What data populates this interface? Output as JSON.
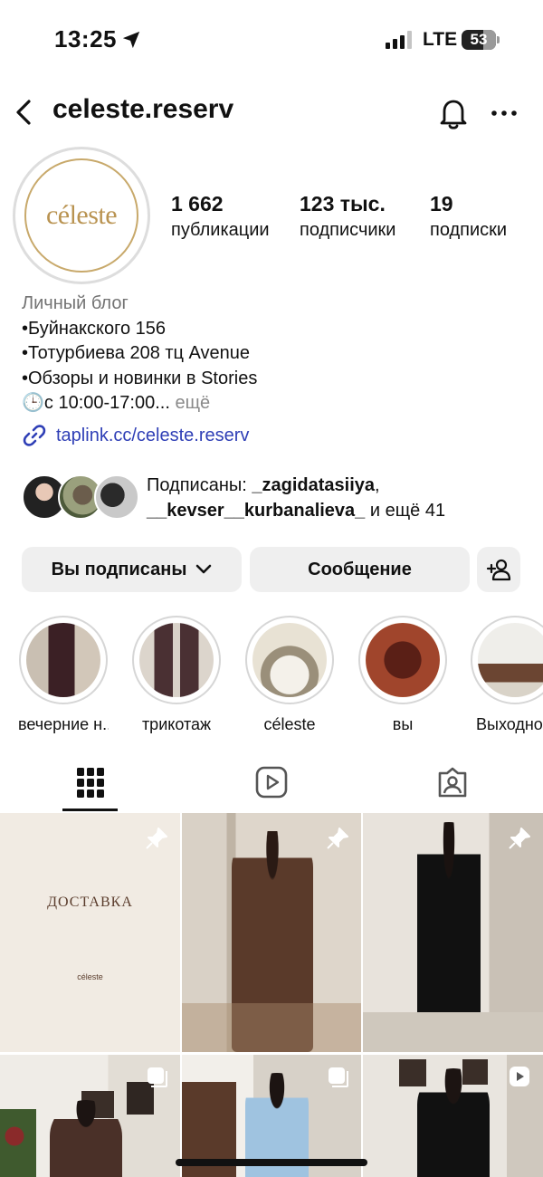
{
  "status": {
    "time": "13:25",
    "network": "LTE",
    "battery": "53"
  },
  "header": {
    "username": "celeste.reserv"
  },
  "profile": {
    "avatar_text": "céleste",
    "stats": [
      {
        "value": "1 662",
        "label": "публикации"
      },
      {
        "value": "123 тыс.",
        "label": "подписчики"
      },
      {
        "value": "19",
        "label": "подписки"
      }
    ],
    "category": "Личный блог",
    "bio_lines": [
      "•Буйнакского 156",
      "•Тотурбиева 208 тц Avenue",
      "•Обзоры и новинки в Stories"
    ],
    "bio_last": "🕒с 10:00-17:00...",
    "bio_more": "ещё",
    "link": "taplink.cc/celeste.reserv"
  },
  "followed_by": {
    "prefix": "Подписаны: ",
    "user1": "_zagidatasiiya",
    "comma": ",",
    "user2": "__kevser__kurbanalieva_",
    "suffix": " и ещё 41"
  },
  "buttons": {
    "following": "Вы подписаны",
    "message": "Сообщение"
  },
  "highlights": [
    {
      "label": "вечерние н..."
    },
    {
      "label": "трикотаж"
    },
    {
      "label": "céleste"
    },
    {
      "label": "вы"
    },
    {
      "label": "Выходно"
    }
  ],
  "posts": {
    "first_title": "ДОСТАВКА",
    "first_brand": "céleste"
  },
  "colors": {
    "link": "#2f3fb6",
    "brand_gold": "#b99351",
    "button_bg": "#efefef"
  }
}
